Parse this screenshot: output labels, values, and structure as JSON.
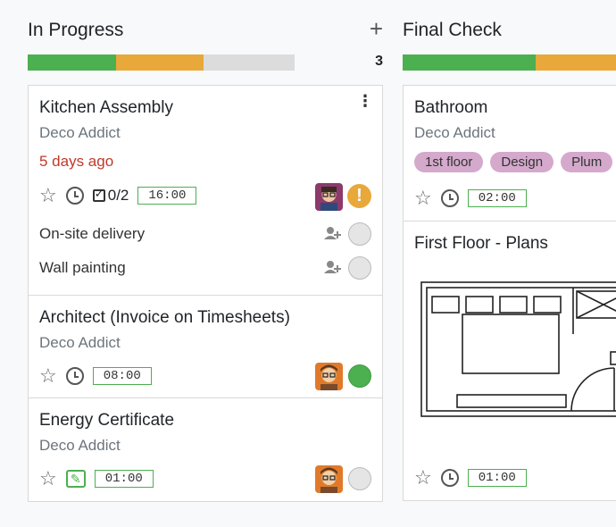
{
  "columns": [
    {
      "title": "In Progress",
      "count": "3",
      "progress": {
        "done": 0.33,
        "in_progress": 0.33
      },
      "cards": [
        {
          "title": "Kitchen Assembly",
          "customer": "Deco Addict",
          "date": "5 days ago",
          "checklist": "0/2",
          "hours": "16:00",
          "status": "blocked",
          "subtasks": [
            {
              "label": "On-site delivery"
            },
            {
              "label": "Wall painting"
            }
          ]
        },
        {
          "title": "Architect (Invoice on Timesheets)",
          "customer": "Deco Addict",
          "hours": "08:00",
          "status": "done"
        },
        {
          "title": "Energy Certificate",
          "customer": "Deco Addict",
          "hours": "01:00",
          "status": "normal"
        }
      ]
    },
    {
      "title": "Final Check",
      "progress": {
        "done": 0.5,
        "in_progress": 0.5
      },
      "cards": [
        {
          "title": "Bathroom",
          "customer": "Deco Addict",
          "tags": [
            "1st floor",
            "Design",
            "Plum"
          ],
          "hours": "02:00"
        },
        {
          "title": "First Floor - Plans",
          "hours": "01:00"
        }
      ]
    }
  ],
  "colors": {
    "green": "#4caf50",
    "orange": "#e8a83a",
    "tag": "#d4a9cc",
    "overdue": "#c0392b"
  }
}
